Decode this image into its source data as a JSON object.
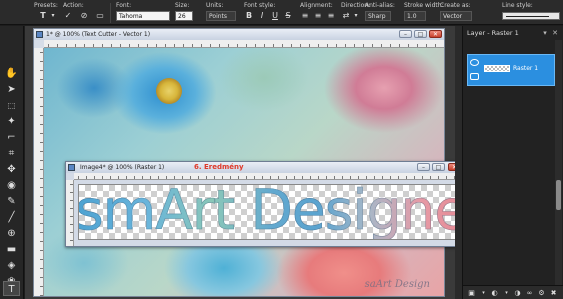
{
  "toolbar_options": {
    "presets_label": "Presets:",
    "action_label": "Action:",
    "font_label": "Font:",
    "font_value": "Tahoma",
    "size_label": "Size:",
    "size_value": "26",
    "units_label": "Units:",
    "units_value": "Points",
    "font_style_label": "Font style:",
    "alignment_label": "Alignment:",
    "direction_label": "Direction:",
    "antialias_label": "Anti-alias:",
    "antialias_value": "Sharp",
    "stroke_width_label": "Stroke width:",
    "stroke_width_value": "1.0",
    "create_as_label": "Create as:",
    "create_as_value": "Vector",
    "line_style_label": "Line style:"
  },
  "main_window": {
    "title": "1* @ 100% (Text Cutter - Vector 1)"
  },
  "canvas": {
    "watermark": "saArt Design"
  },
  "image_window": {
    "title": "Image4* @ 100% (Raster 1)",
    "result_label": "6. Eredmény",
    "big_text": "smArt Designe"
  },
  "layers_panel": {
    "title": "Layer - Raster 1",
    "layer_name": "Raster 1"
  },
  "colors": {
    "accent_selection": "#2b8fe0",
    "result_label": "#e03a2a",
    "app_background": "#1d1d1d"
  }
}
